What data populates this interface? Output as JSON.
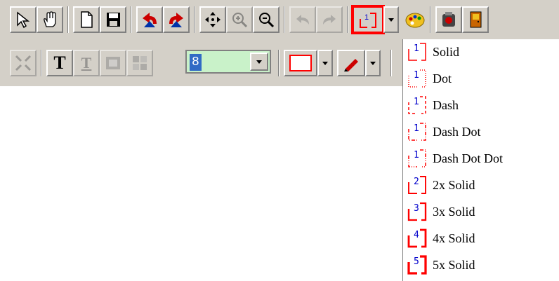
{
  "toolbar_top": {
    "buttons": [
      {
        "id": "select",
        "icon": "arrow-pointer-icon"
      },
      {
        "id": "pan",
        "icon": "hand-icon"
      },
      {
        "id": "new",
        "icon": "new-page-icon"
      },
      {
        "id": "save",
        "icon": "floppy-disk-icon"
      },
      {
        "id": "rotate-left",
        "icon": "rotate-left-icon"
      },
      {
        "id": "rotate-right",
        "icon": "rotate-right-icon"
      },
      {
        "id": "move",
        "icon": "move-arrows-icon"
      },
      {
        "id": "zoom-in",
        "icon": "zoom-in-icon"
      },
      {
        "id": "zoom-out",
        "icon": "zoom-out-icon"
      },
      {
        "id": "undo",
        "icon": "undo-icon"
      },
      {
        "id": "redo",
        "icon": "redo-icon"
      },
      {
        "id": "line-style",
        "icon": "line-style-icon",
        "label": "1",
        "highlighted": true
      },
      {
        "id": "line-style-dropdown",
        "icon": "chevron-down-icon"
      },
      {
        "id": "palette",
        "icon": "palette-icon"
      },
      {
        "id": "tools",
        "icon": "tools-icon"
      },
      {
        "id": "exit",
        "icon": "exit-door-icon"
      }
    ]
  },
  "toolbar_second": {
    "text_tool_label": "T",
    "text_tool_shadow_label": "T",
    "font_size_value": "8",
    "border_color": "#ff0000",
    "pen_color": "#cc0000"
  },
  "line_style_menu": {
    "items": [
      {
        "label": "Solid",
        "number": "1",
        "style": "solid"
      },
      {
        "label": "Dot",
        "number": "1",
        "style": "dot"
      },
      {
        "label": "Dash",
        "number": "1",
        "style": "dash"
      },
      {
        "label": "Dash Dot",
        "number": "1",
        "style": "dashdot"
      },
      {
        "label": "Dash Dot Dot",
        "number": "1",
        "style": "dashdotdot"
      },
      {
        "label": "2x Solid",
        "number": "2",
        "style": "solid"
      },
      {
        "label": "3x Solid",
        "number": "3",
        "style": "solid"
      },
      {
        "label": "4x Solid",
        "number": "4",
        "style": "solid"
      },
      {
        "label": "5x Solid",
        "number": "5",
        "style": "solid"
      }
    ]
  },
  "colors": {
    "toolbar_bg": "#d4d0c8",
    "highlight": "#ff0000",
    "menu_number": "#0000cc",
    "menu_line": "#ff0000"
  }
}
